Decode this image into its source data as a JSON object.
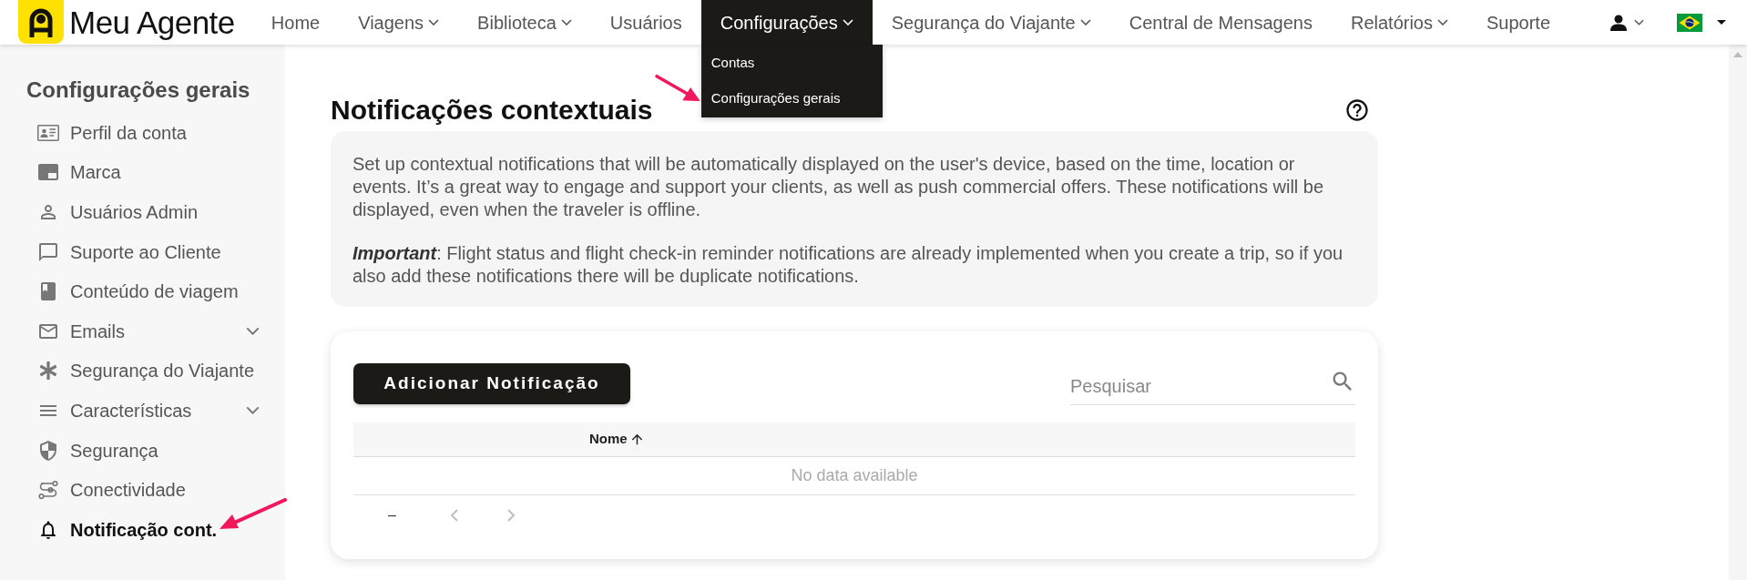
{
  "navbar": {
    "brand": "Meu Agente",
    "items": [
      {
        "label": "Home",
        "has_dropdown": false,
        "selected": false
      },
      {
        "label": "Viagens",
        "has_dropdown": true,
        "selected": false
      },
      {
        "label": "Biblioteca",
        "has_dropdown": true,
        "selected": false
      },
      {
        "label": "Usuários",
        "has_dropdown": false,
        "selected": false
      },
      {
        "label": "Configurações",
        "has_dropdown": true,
        "selected": true,
        "menu": [
          "Contas",
          "Configurações gerais"
        ]
      },
      {
        "label": "Segurança do Viajante",
        "has_dropdown": true,
        "selected": false
      },
      {
        "label": "Central de Mensagens",
        "has_dropdown": false,
        "selected": false
      },
      {
        "label": "Relatórios",
        "has_dropdown": true,
        "selected": false
      },
      {
        "label": "Suporte",
        "has_dropdown": false,
        "selected": false
      }
    ]
  },
  "sidebar": {
    "title": "Configurações gerais",
    "items": [
      {
        "label": "Perfil da conta",
        "has_submenu": false,
        "selected": false
      },
      {
        "label": "Marca",
        "has_submenu": false,
        "selected": false
      },
      {
        "label": "Usuários Admin",
        "has_submenu": false,
        "selected": false
      },
      {
        "label": "Suporte ao Cliente",
        "has_submenu": false,
        "selected": false
      },
      {
        "label": "Conteúdo de viagem",
        "has_submenu": false,
        "selected": false
      },
      {
        "label": "Emails",
        "has_submenu": true,
        "selected": false
      },
      {
        "label": "Segurança do Viajante",
        "has_submenu": false,
        "selected": false
      },
      {
        "label": "Características",
        "has_submenu": true,
        "selected": false
      },
      {
        "label": "Segurança",
        "has_submenu": false,
        "selected": false
      },
      {
        "label": "Conectividade",
        "has_submenu": false,
        "selected": false
      },
      {
        "label": "Notificação cont.",
        "has_submenu": false,
        "selected": true
      }
    ]
  },
  "main": {
    "title": "Notificações contextuais",
    "info": {
      "paragraph": "Set up contextual notifications that will be automatically displayed on the user's device, based on the time, location or events. It’s a great way to engage and support your clients, as well as push commercial offers. These notifications will be displayed, even when the traveler is offline.",
      "important_label": "Important",
      "important_text": ": Flight status and flight check-in reminder notifications are already implemented when you create a trip, so if you also add these notifications there will be duplicate notifications."
    },
    "table_card": {
      "add_button": "Adicionar Notificação",
      "search": {
        "placeholder": "Pesquisar"
      },
      "columns": [
        {
          "label": "Nome",
          "sorted": true,
          "ascending": true
        }
      ],
      "empty_message": "No data available",
      "pagination": {
        "range": "–"
      }
    }
  }
}
